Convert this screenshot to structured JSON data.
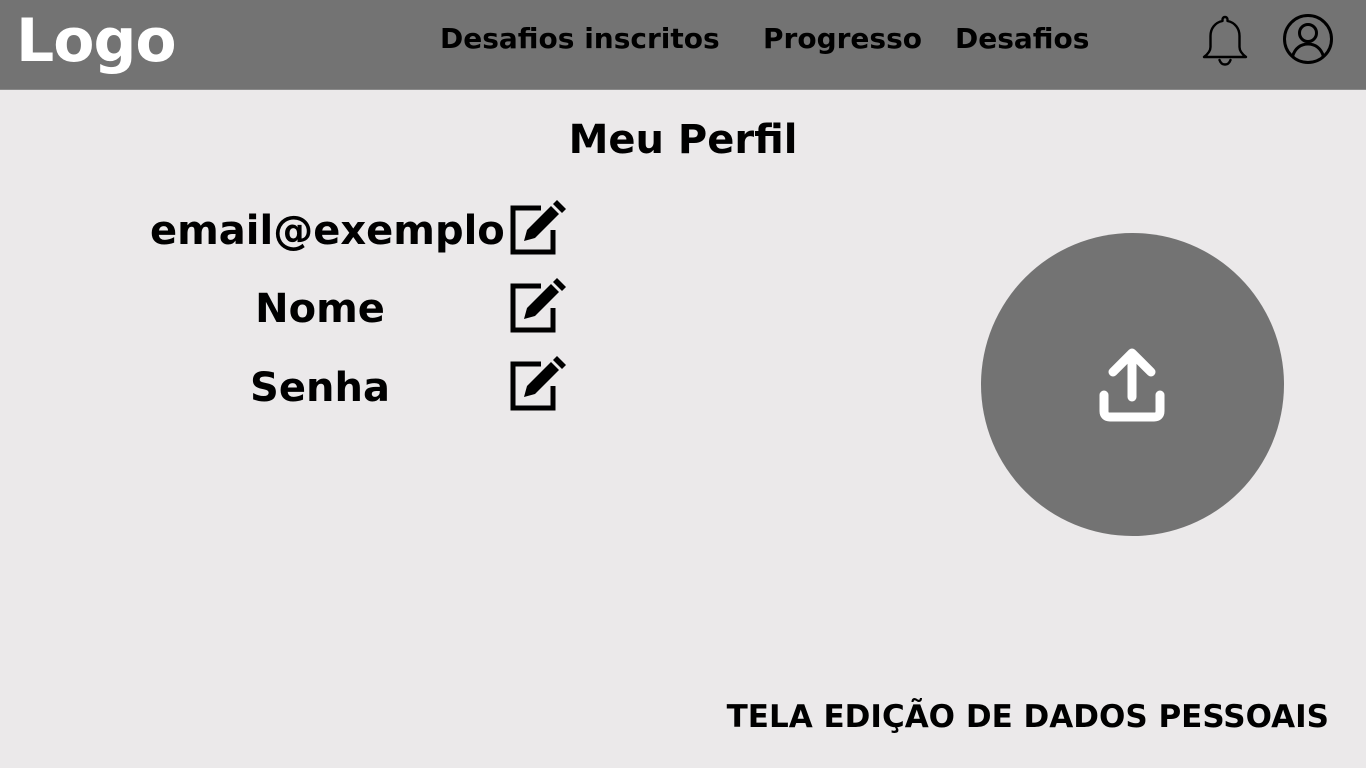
{
  "header": {
    "logo": "Logo",
    "nav": [
      "Desafios inscritos",
      "Progresso",
      "Desafios"
    ]
  },
  "main": {
    "title": "Meu Perfil",
    "fields": [
      "email@exemplo",
      "Nome",
      "Senha"
    ]
  },
  "footer": {
    "caption": "TELA EDIÇÃO DE DADOS PESSOAIS"
  },
  "icons": {
    "notifications": "bell-icon",
    "account": "user-circle-icon",
    "edit": "edit-icon",
    "upload": "upload-icon"
  },
  "colors": {
    "header_bg": "#737373",
    "page_bg": "#ebe9ea",
    "avatar_bg": "#737373"
  }
}
